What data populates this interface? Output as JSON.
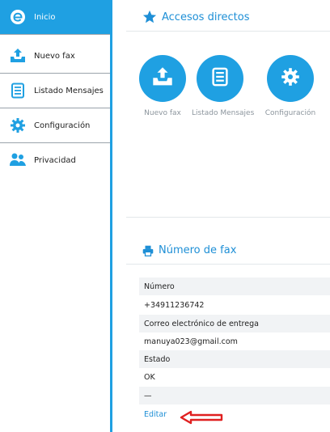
{
  "sidebar": {
    "items": [
      {
        "label": "Inicio",
        "icon": "e-logo-icon"
      },
      {
        "label": "Nuevo fax",
        "icon": "upload-tray-icon"
      },
      {
        "label": "Listado Mensajes",
        "icon": "document-list-icon"
      },
      {
        "label": "Configuración",
        "icon": "gear-icon"
      },
      {
        "label": "Privacidad",
        "icon": "users-icon"
      }
    ],
    "active_index": 0
  },
  "shortcuts": {
    "title": "Accesos directos",
    "items": [
      {
        "label": "Nuevo fax",
        "icon": "upload-tray-icon"
      },
      {
        "label": "Listado Mensajes",
        "icon": "document-list-icon"
      },
      {
        "label": "Configuración",
        "icon": "gear-icon"
      }
    ]
  },
  "fax": {
    "title": "Número de fax",
    "rows": [
      "Número",
      "+34911236742",
      "Correo electrónico de entrega",
      "manuya023@gmail.com",
      "Estado",
      "OK",
      "—"
    ],
    "edit_label": "Editar"
  },
  "colors": {
    "accent": "#1fa0e2",
    "link": "#1e8fd6",
    "arrow": "#e02020"
  }
}
